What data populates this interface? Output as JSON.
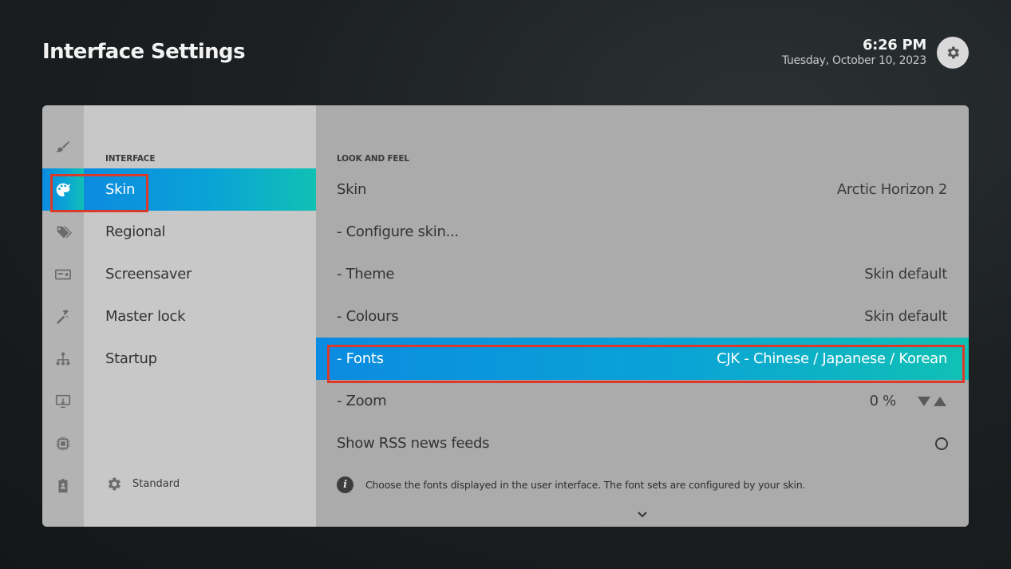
{
  "header": {
    "title": "Interface Settings",
    "time": "6:26 PM",
    "date": "Tuesday, October 10, 2023"
  },
  "categories": {
    "section_label": "INTERFACE",
    "items": [
      {
        "label": "Skin",
        "icon": "palette-icon",
        "active": true
      },
      {
        "label": "Regional",
        "icon": "tags-icon"
      },
      {
        "label": "Screensaver",
        "icon": "screensaver-icon"
      },
      {
        "label": "Master lock",
        "icon": "wrench-icon"
      },
      {
        "label": "Startup",
        "icon": "network-icon"
      }
    ],
    "level_label": "Standard"
  },
  "rail_icons": [
    "brush-icon",
    "palette-icon",
    "tags-icon",
    "screensaver-icon",
    "wrench-icon",
    "network-icon",
    "display-icon",
    "chip-icon",
    "badge-icon"
  ],
  "settings": {
    "section_label": "LOOK AND FEEL",
    "rows": [
      {
        "label": "Skin",
        "value": "Arctic Horizon 2"
      },
      {
        "label": "- Configure skin...",
        "value": ""
      },
      {
        "label": "- Theme",
        "value": "Skin default"
      },
      {
        "label": "- Colours",
        "value": "Skin default"
      },
      {
        "label": "- Fonts",
        "value": "CJK - Chinese / Japanese / Korean",
        "active": true
      },
      {
        "label": "- Zoom",
        "value": "0 %"
      },
      {
        "label": "Show RSS news feeds",
        "value": "",
        "toggle": false
      }
    ],
    "description": "Choose the fonts displayed in the user interface. The font sets are configured by your skin."
  },
  "colors": {
    "highlight_start": "#0b8be0",
    "highlight_end": "#10c1b4",
    "annotation": "#d93a2b"
  }
}
